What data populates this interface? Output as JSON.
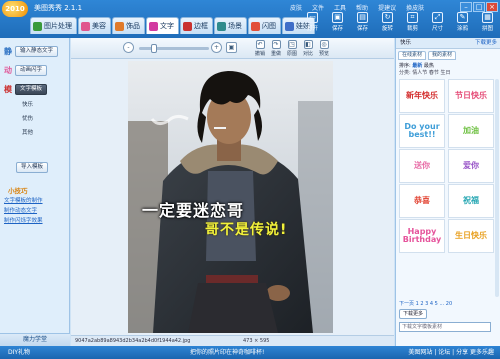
{
  "app": {
    "logo_text": "2010",
    "title": "美图秀秀 2.1.1",
    "menus": [
      "皮肤",
      "文件",
      "工具",
      "帮助",
      "提建议",
      "换皮肤"
    ],
    "window_buttons": [
      "–",
      "□",
      "×"
    ]
  },
  "tabs": [
    {
      "label": "图片处理",
      "color": "#3a9a3a"
    },
    {
      "label": "美容",
      "color": "#e0568e"
    },
    {
      "label": "饰品",
      "color": "#e07a2a"
    },
    {
      "label": "文字",
      "color": "#d23ba0"
    },
    {
      "label": "边框",
      "color": "#c9312f"
    },
    {
      "label": "场景",
      "color": "#2f8b8d"
    },
    {
      "label": "闪图",
      "color": "#e24f3a"
    },
    {
      "label": "娃娃",
      "color": "#3f6ec8"
    }
  ],
  "active_tab_index": 3,
  "toolbar": [
    {
      "label": "打开",
      "icon": "folder-icon"
    },
    {
      "label": "保存",
      "icon": "save-icon"
    },
    {
      "label": "保存",
      "icon": "save-as-icon"
    },
    {
      "label": "旋转",
      "icon": "rotate-icon"
    },
    {
      "label": "裁剪",
      "icon": "crop-icon"
    },
    {
      "label": "尺寸",
      "icon": "resize-icon"
    },
    {
      "label": "涂鸦",
      "icon": "paint-icon"
    },
    {
      "label": "拼图",
      "icon": "collage-icon"
    },
    {
      "label": "批量",
      "icon": "batch-icon"
    }
  ],
  "left": {
    "static_label": "静",
    "static_button": "输入静态文字",
    "animated_label": "动",
    "animated_button": "动画闪字",
    "template_label": "模",
    "template_button": "文字模板",
    "template_items": [
      "快乐",
      "忧伤",
      "其他"
    ],
    "import_button": "导入模板",
    "tips_title": "小技巧",
    "tips": [
      "文字模板的制作",
      "制作动态文字",
      "制作闪烁字效果"
    ],
    "footer": "魔力学堂"
  },
  "canvas": {
    "zoom_out_icon": "-",
    "zoom_in_icon": "+",
    "zoom_level": 0.18,
    "tools": [
      {
        "label": "撤销",
        "glyph": "↶"
      },
      {
        "label": "重做",
        "glyph": "↷"
      },
      {
        "label": "原图",
        "glyph": "◳"
      },
      {
        "label": "对比",
        "glyph": "◧"
      },
      {
        "label": "预览",
        "glyph": "◎"
      }
    ],
    "filename": "9047a2ab89a8943d2b34a2b4d0f1944a42.jpg",
    "dimensions": "473 × 595"
  },
  "photo": {
    "caption_line1": "一定要迷恋哥",
    "caption_line2": "哥不是传说!"
  },
  "right": {
    "header_left": "快乐",
    "header_right": "下载更多",
    "tabs": [
      "在线素材",
      "我的素材"
    ],
    "sort_label": "排序:",
    "sort_options": [
      "最新",
      "最热"
    ],
    "tags_label": "分类:",
    "tags": [
      "情人节",
      "春节",
      "生日"
    ],
    "stickers": [
      {
        "text": "新年快乐",
        "color": "#d32c2c"
      },
      {
        "text": "节日快乐",
        "color": "#e54c77"
      },
      {
        "text": "Do your best!!",
        "color": "#3f9ed8"
      },
      {
        "text": "加油",
        "color": "#6bbf3e"
      },
      {
        "text": "送你",
        "color": "#e86fa8"
      },
      {
        "text": "爱你",
        "color": "#9b59c9"
      },
      {
        "text": "恭喜",
        "color": "#e34b3b"
      },
      {
        "text": "祝福",
        "color": "#27a7b3"
      },
      {
        "text": "Happy Birthday",
        "color": "#e6549c"
      },
      {
        "text": "生日快乐",
        "color": "#e8a020"
      }
    ],
    "pager": "下一页  1 2 3 4 5 ... 20",
    "download_button": "下载更多",
    "search_placeholder": "下载文字模板素材"
  },
  "bottom": {
    "left": "DIY礼物",
    "center": "把你的照片印在神奇咖啡杯!",
    "right": "美图网站 | 论坛 | 分享 更多乐趣"
  }
}
